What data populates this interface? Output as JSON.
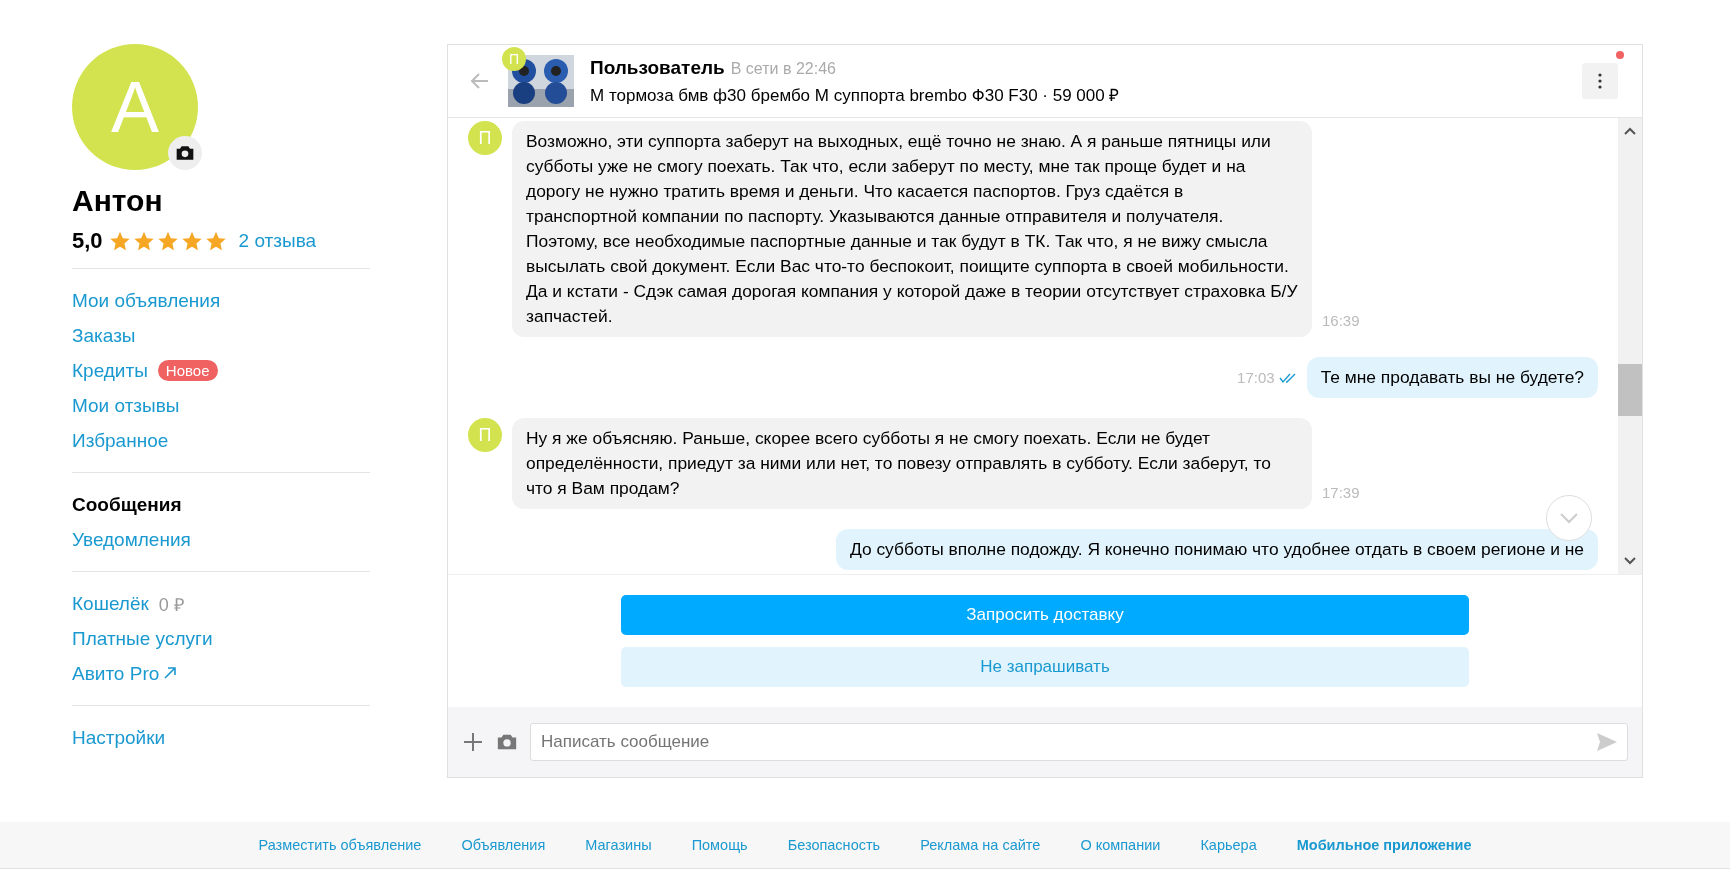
{
  "profile": {
    "initial": "А",
    "name": "Антон",
    "rating": "5,0",
    "stars": 5,
    "reviews": "2 отзыва"
  },
  "sidebar": {
    "groups": [
      [
        {
          "label": "Мои объявления",
          "selected": false,
          "kind": "link"
        },
        {
          "label": "Заказы",
          "selected": false,
          "kind": "link"
        },
        {
          "label": "Кредиты",
          "selected": false,
          "kind": "link",
          "badge": "Новое"
        },
        {
          "label": "Мои отзывы",
          "selected": false,
          "kind": "link"
        },
        {
          "label": "Избранное",
          "selected": false,
          "kind": "link"
        }
      ],
      [
        {
          "label": "Сообщения",
          "selected": true,
          "kind": "link"
        },
        {
          "label": "Уведомления",
          "selected": false,
          "kind": "link"
        }
      ],
      [
        {
          "label": "Кошелёк",
          "selected": false,
          "kind": "link",
          "extra": "0 ₽"
        },
        {
          "label": "Платные услуги",
          "selected": false,
          "kind": "link"
        },
        {
          "label": "Авито Pro",
          "selected": false,
          "kind": "external"
        }
      ],
      [
        {
          "label": "Настройки",
          "selected": false,
          "kind": "link"
        }
      ]
    ]
  },
  "chat": {
    "header": {
      "avatar_letter": "П",
      "user": "Пользователь",
      "status": "В сети в 22:46",
      "item": "М тормоза бмв ф30 брембо М суппорта brembo Ф30 F30 · 59 000 ₽",
      "notification": true
    },
    "messages": [
      {
        "kind": "incoming",
        "avatar_letter": "П",
        "text": "Возможно, эти суппорта заберут на выходных, ещё точно не знаю. А я раньше пятницы или субботы уже не смогу поехать. Так что, если заберут по месту, мне так проще будет и на дорогу не нужно тратить время и деньги. Что касается паспортов. Груз сдаётся в транспортной компании по паспорту. Указываются данные отправителя и получателя. Поэтому, все необходимые паспортные данные и так будут в ТК. Так что, я не вижу смысла высылать свой документ. Если Вас что-то беспокоит, поищите суппорта в своей мобильности. Да и кстати - Сдэк самая дорогая компания у которой даже в теории отсутствует страховка Б/У запчастей.",
        "time": "16:39"
      },
      {
        "kind": "outgoing",
        "text": "Те мне продавать вы не будете?",
        "time": "17:03",
        "read": true
      },
      {
        "kind": "incoming",
        "avatar_letter": "П",
        "text": "Ну я же объясняю. Раньше, скорее всего субботы я не смогу поехать. Если не будет определённости, приедут за ними или нет, то повезу отправлять в субботу. Если заберут, то что я Вам продам?",
        "time": "17:39"
      },
      {
        "kind": "outgoing",
        "text": "До субботы  вполне подожду. Я конечно понимаю что удобнее отдать в своем регионе и не"
      }
    ],
    "actions": [
      {
        "label": "Запросить доставку",
        "kind": "primary"
      },
      {
        "label": "Не запрашивать",
        "kind": "secondary"
      }
    ],
    "input": {
      "placeholder": "Написать сообщение"
    }
  },
  "footer": {
    "links": [
      {
        "label": "Разместить объявление",
        "emphasized": false
      },
      {
        "label": "Объявления",
        "emphasized": false
      },
      {
        "label": "Магазины",
        "emphasized": false
      },
      {
        "label": "Помощь",
        "emphasized": false
      },
      {
        "label": "Безопасность",
        "emphasized": false
      },
      {
        "label": "Реклама на сайте",
        "emphasized": false
      },
      {
        "label": "О компании",
        "emphasized": false
      },
      {
        "label": "Карьера",
        "emphasized": false
      },
      {
        "label": "Мобильное приложение",
        "emphasized": true
      }
    ]
  }
}
